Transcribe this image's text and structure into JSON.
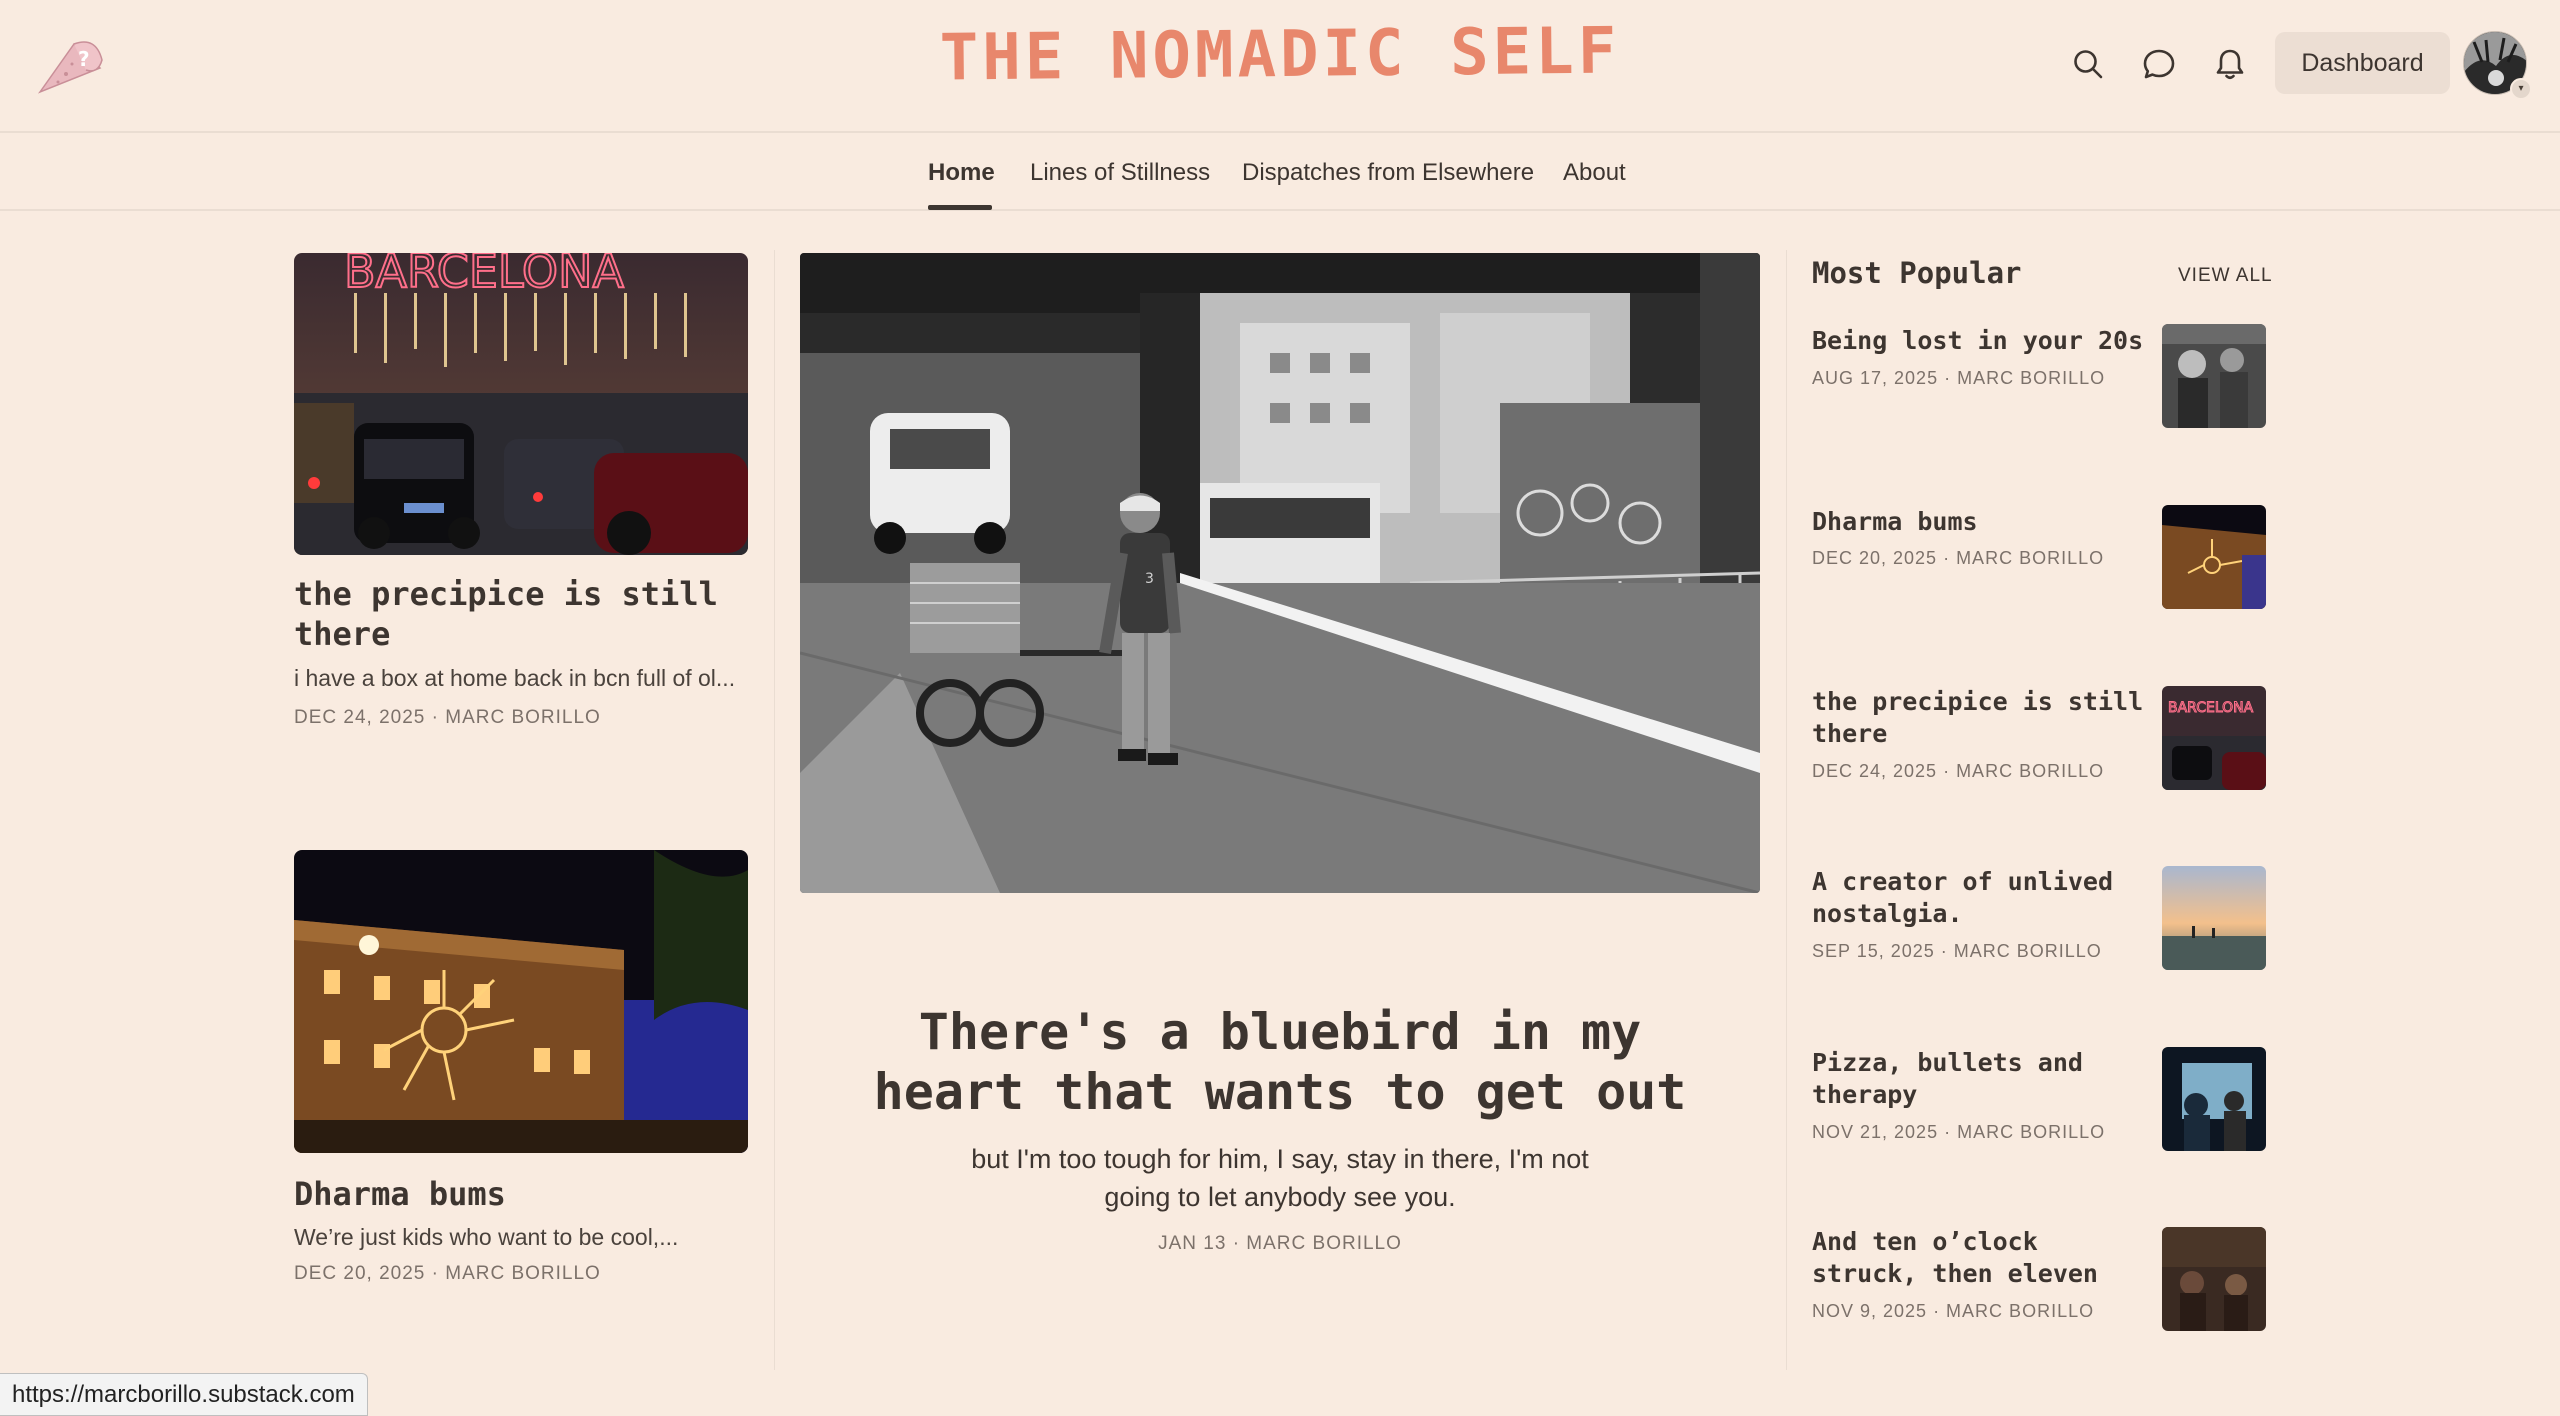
{
  "header": {
    "title": "THE NOMADIC SELF",
    "dashboard_label": "Dashboard"
  },
  "nav": {
    "items": [
      {
        "label": "Home",
        "active": true
      },
      {
        "label": "Lines of Stillness"
      },
      {
        "label": "Dispatches from Elsewhere"
      },
      {
        "label": "About"
      }
    ]
  },
  "left_posts": [
    {
      "title": "the precipice is still there",
      "subtitle": "i have a box at home back in bcn full of ol...",
      "meta": "DEC 24, 2025 · MARC BORILLO",
      "sign_text": "BARCELONA"
    },
    {
      "title": "Dharma bums",
      "subtitle": "We’re just kids who want to be cool,...",
      "meta": "DEC 20, 2025 · MARC BORILLO"
    }
  ],
  "hero": {
    "title": "There's a bluebird in my heart that wants to get out",
    "subtitle": "but I'm too tough for him, I say, stay in there, I'm not going to let anybody see you.",
    "meta": "JAN 13 · MARC BORILLO"
  },
  "sidebar": {
    "heading": "Most Popular",
    "view_all": "VIEW ALL",
    "items": [
      {
        "title": "Being lost in your 20s",
        "meta": "AUG 17, 2025 · MARC BORILLO"
      },
      {
        "title": "Dharma bums",
        "meta": "DEC 20, 2025 · MARC BORILLO"
      },
      {
        "title": "the precipice is still there",
        "meta": "DEC 24, 2025 · MARC BORILLO"
      },
      {
        "title": "A creator of unlived nostalgia.",
        "meta": "SEP 15, 2025 · MARC BORILLO"
      },
      {
        "title": "Pizza, bullets and therapy",
        "meta": "NOV 21, 2025 · MARC BORILLO"
      },
      {
        "title": "And ten o’clock struck, then eleven",
        "meta": "NOV 9, 2025 · MARC BORILLO"
      }
    ]
  },
  "status_bar": {
    "url": "https://marcborillo.substack.com"
  },
  "colors": {
    "background": "#f9ebe0",
    "title_accent": "#e8876c",
    "text": "#3d3530",
    "meta": "#7c716a"
  },
  "icons": {
    "logo": "pink-cone-logo-icon",
    "search": "search-icon",
    "chat": "chat-icon",
    "notifications": "bell-icon"
  }
}
